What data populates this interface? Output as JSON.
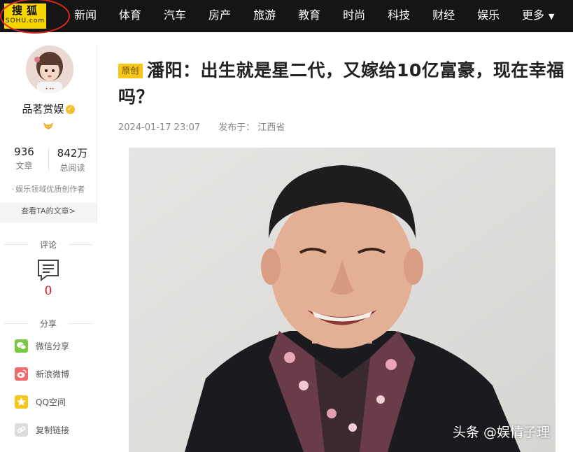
{
  "logo": {
    "cn": "搜狐",
    "en": "SOHU.com"
  },
  "nav": {
    "items": [
      "新闻",
      "体育",
      "汽车",
      "房产",
      "旅游",
      "教育",
      "时尚",
      "科技",
      "财经",
      "娱乐"
    ],
    "more": "更多"
  },
  "author": {
    "name": "品茗赏娱",
    "articles_count": "936",
    "articles_label": "文章",
    "reads_count": "842万",
    "reads_label": "总阅读",
    "creator_title": "娱乐领域优质创作者",
    "view_articles": "查看TA的文章>"
  },
  "comments": {
    "label": "评论",
    "count": "0"
  },
  "share": {
    "label": "分享",
    "items": [
      {
        "label": "微信分享",
        "icon": "wechat-icon",
        "color": "#7ac943"
      },
      {
        "label": "新浪微博",
        "icon": "weibo-icon",
        "color": "#f06a6a"
      },
      {
        "label": "QQ空间",
        "icon": "qzone-icon",
        "color": "#f7c61c"
      },
      {
        "label": "复制链接",
        "icon": "link-icon",
        "color": "#dddddd"
      }
    ]
  },
  "article": {
    "tag": "原创",
    "title": "潘阳：出生就是星二代，又嫁给10亿富豪，现在幸福吗？",
    "datetime": "2024-01-17 23:07",
    "published_label": "发布于：",
    "location": "江西省",
    "watermark": "头条 @娱情子理"
  },
  "colors": {
    "topbar_bg": "#151515",
    "logo_yellow": "#f6d600",
    "tag_yellow": "#f7c61c",
    "comment_count_red": "#d11111"
  }
}
